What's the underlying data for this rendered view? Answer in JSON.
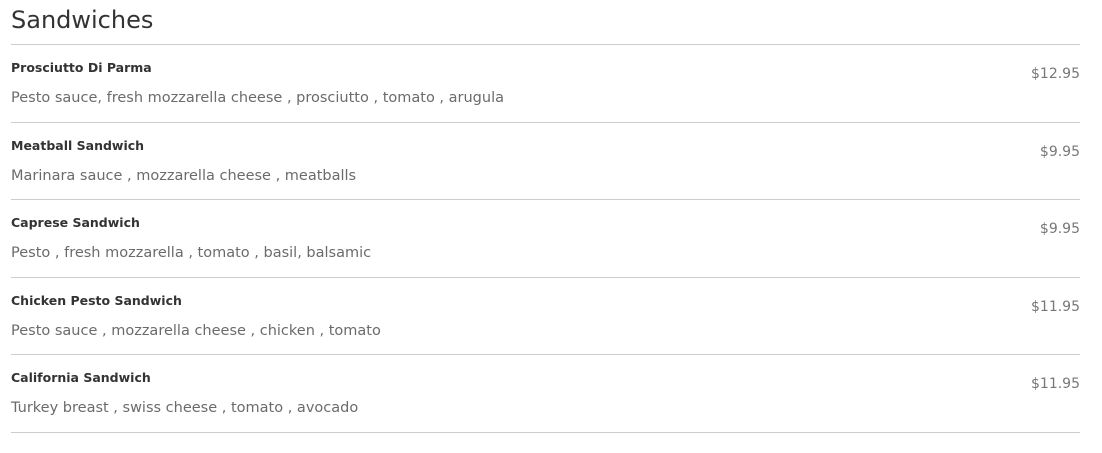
{
  "section": {
    "title": "Sandwiches"
  },
  "items": [
    {
      "name": "Prosciutto Di Parma",
      "description": "Pesto sauce, fresh mozzarella cheese , prosciutto , tomato , arugula",
      "price": "$12.95"
    },
    {
      "name": "Meatball Sandwich",
      "description": "Marinara sauce , mozzarella cheese , meatballs",
      "price": "$9.95"
    },
    {
      "name": "Caprese Sandwich",
      "description": "Pesto , fresh mozzarella , tomato , basil, balsamic",
      "price": "$9.95"
    },
    {
      "name": "Chicken Pesto Sandwich",
      "description": "Pesto sauce , mozzarella cheese , chicken , tomato",
      "price": "$11.95"
    },
    {
      "name": "California Sandwich",
      "description": "Turkey breast , swiss cheese , tomato , avocado",
      "price": "$11.95"
    }
  ],
  "colors": {
    "text": "#333333",
    "description": "#6b6b6b",
    "price": "#777777",
    "divider": "#cccccc"
  }
}
